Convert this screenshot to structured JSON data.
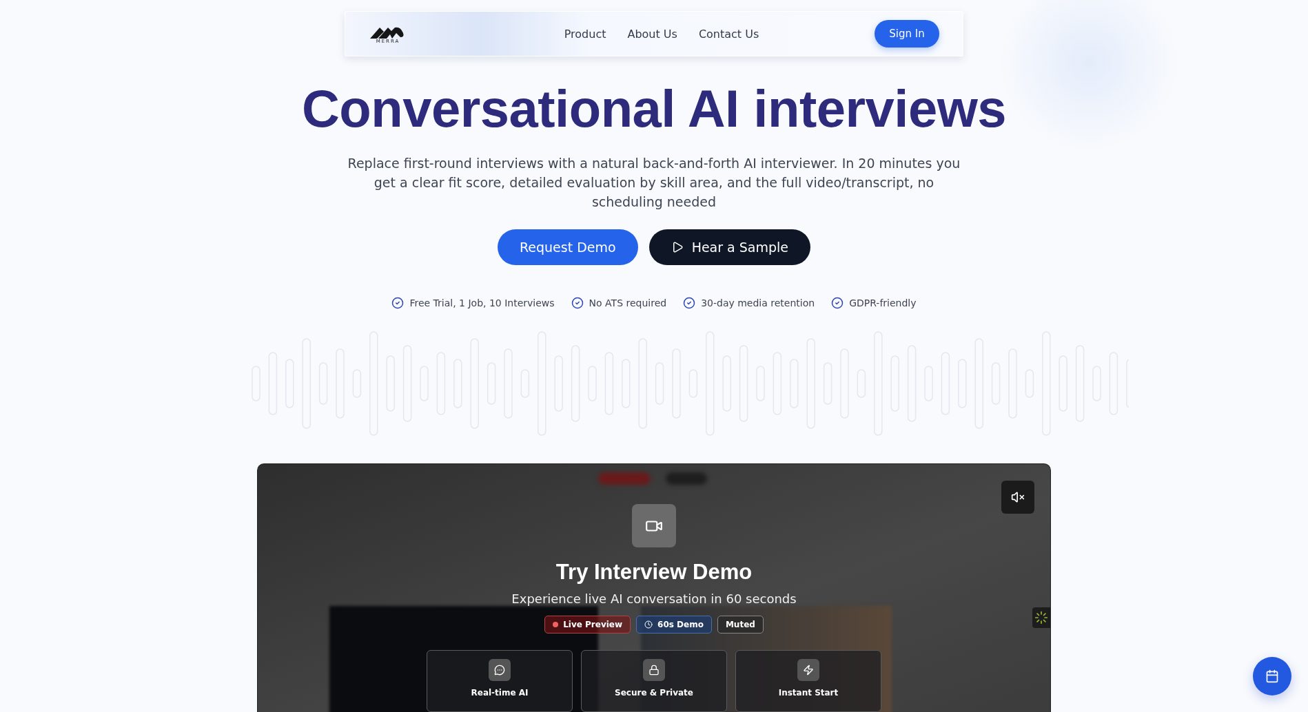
{
  "nav": {
    "logo_text": "MERRA",
    "links": [
      "Product",
      "About Us",
      "Contact Us"
    ],
    "sign_in": "Sign In"
  },
  "hero": {
    "title": "Conversational AI interviews",
    "description": "Replace first-round interviews with a natural back-and-forth AI interviewer. In 20 minutes you get a clear fit score, detailed evaluation by skill area, and the full video/transcript, no scheduling needed",
    "buttons": [
      {
        "label": "Request Demo",
        "kind": "primary"
      },
      {
        "label": "Hear a Sample",
        "kind": "dark"
      }
    ],
    "features": [
      "Free Trial, 1 Job, 10 Interviews",
      "No ATS required",
      "30-day media retention",
      "GDPR-friendly"
    ]
  },
  "demo": {
    "title": "Try Interview Demo",
    "subtitle": "Experience live AI conversation in 60 seconds",
    "badges": [
      {
        "label": "Live Preview",
        "kind": "live"
      },
      {
        "label": "60s Demo",
        "kind": "timer"
      },
      {
        "label": "Muted",
        "kind": "plain"
      }
    ],
    "cards": [
      {
        "label": "Real-time AI",
        "kind": "chat"
      },
      {
        "label": "Secure & Private",
        "kind": "lock"
      },
      {
        "label": "Instant Start",
        "kind": "bolt"
      }
    ]
  }
}
